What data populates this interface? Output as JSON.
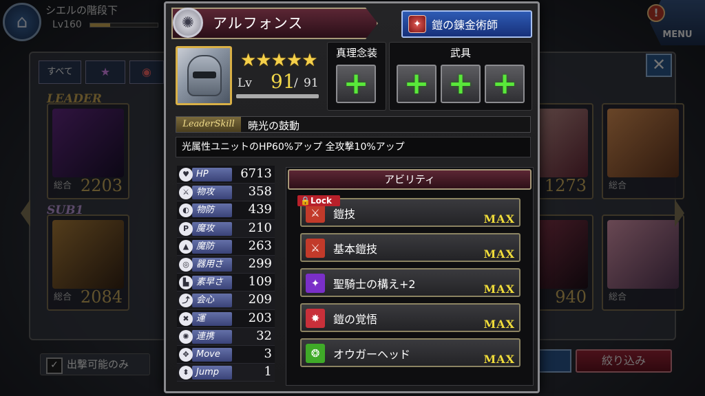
{
  "background": {
    "location": "シエルの階段下",
    "level": "Lv160",
    "menu_label": "MENU",
    "alert_glyph": "!",
    "filter_all": "すべて",
    "leader_label": "LEADER",
    "sub_label": "SUB1",
    "cards": [
      {
        "label": "総合",
        "value": "2203"
      },
      {
        "label": "総合",
        "value": "2084"
      },
      {
        "label": "",
        "value": "1273"
      },
      {
        "label": "総合",
        "value": ""
      },
      {
        "label": "",
        "value": "940"
      },
      {
        "label": "総合",
        "value": ""
      }
    ],
    "sortie_only": "出撃可能のみ",
    "narrow_button": "絞り込み",
    "close_glyph": "✕"
  },
  "character": {
    "name": "アルフォンス",
    "title": "鎧の錬金術師",
    "stars": "★★★★★",
    "rarity": 5,
    "level_label": "Lv",
    "level": "91",
    "level_max": "91",
    "level_progress": 1.0
  },
  "equipment": {
    "truth_title": "真理念装",
    "weapon_title": "武具",
    "slot_glyph": "+"
  },
  "leader_skill": {
    "tag": "LeaderSkill",
    "name": "暁光の鼓動",
    "description": "光属性ユニットのHP60%アップ 全攻撃10%アップ"
  },
  "stats": [
    {
      "icon": "heart-icon",
      "glyph": "♥",
      "label": "HP",
      "value": "6713"
    },
    {
      "icon": "sword-icon",
      "glyph": "⚔",
      "label": "物攻",
      "value": "358"
    },
    {
      "icon": "shield-icon",
      "glyph": "◐",
      "label": "物防",
      "value": "439"
    },
    {
      "icon": "magic-attack-icon",
      "glyph": "P",
      "label": "魔攻",
      "value": "210"
    },
    {
      "icon": "magic-defense-icon",
      "glyph": "▲",
      "label": "魔防",
      "value": "263"
    },
    {
      "icon": "dexterity-icon",
      "glyph": "◎",
      "label": "器用さ",
      "value": "299"
    },
    {
      "icon": "speed-icon",
      "glyph": "▙",
      "label": "素早さ",
      "value": "109"
    },
    {
      "icon": "critical-icon",
      "glyph": "⤴",
      "label": "会心",
      "value": "209"
    },
    {
      "icon": "luck-icon",
      "glyph": "✖",
      "label": "運",
      "value": "203"
    },
    {
      "icon": "chain-icon",
      "glyph": "✺",
      "label": "連携",
      "value": "32"
    },
    {
      "icon": "move-icon",
      "glyph": "✥",
      "label": "Move",
      "value": "3"
    },
    {
      "icon": "jump-icon",
      "glyph": "⬍",
      "label": "Jump",
      "value": "1"
    }
  ],
  "abilities": {
    "header": "アビリティ",
    "lock_label": "Lock",
    "items": [
      {
        "name": "鎧技",
        "level": "MAX",
        "icon_color": "#c23a2a",
        "glyph": "⚔",
        "locked": true
      },
      {
        "name": "基本鎧技",
        "level": "MAX",
        "icon_color": "#c23a2a",
        "glyph": "⚔",
        "locked": false
      },
      {
        "name": "聖騎士の構え+2",
        "level": "MAX",
        "icon_color": "#7a2fc8",
        "glyph": "✦",
        "locked": false
      },
      {
        "name": "鎧の覚悟",
        "level": "MAX",
        "icon_color": "#c8303a",
        "glyph": "✸",
        "locked": false
      },
      {
        "name": "オウガーヘッド",
        "level": "MAX",
        "icon_color": "#3faa28",
        "glyph": "❂",
        "locked": false
      }
    ]
  },
  "colors": {
    "accent_gold": "#d9b046",
    "max_text": "#f0dc3a",
    "plus_green": "#59e83a",
    "title_blue": "#2e5bb4",
    "name_plate": "#5b2634"
  }
}
